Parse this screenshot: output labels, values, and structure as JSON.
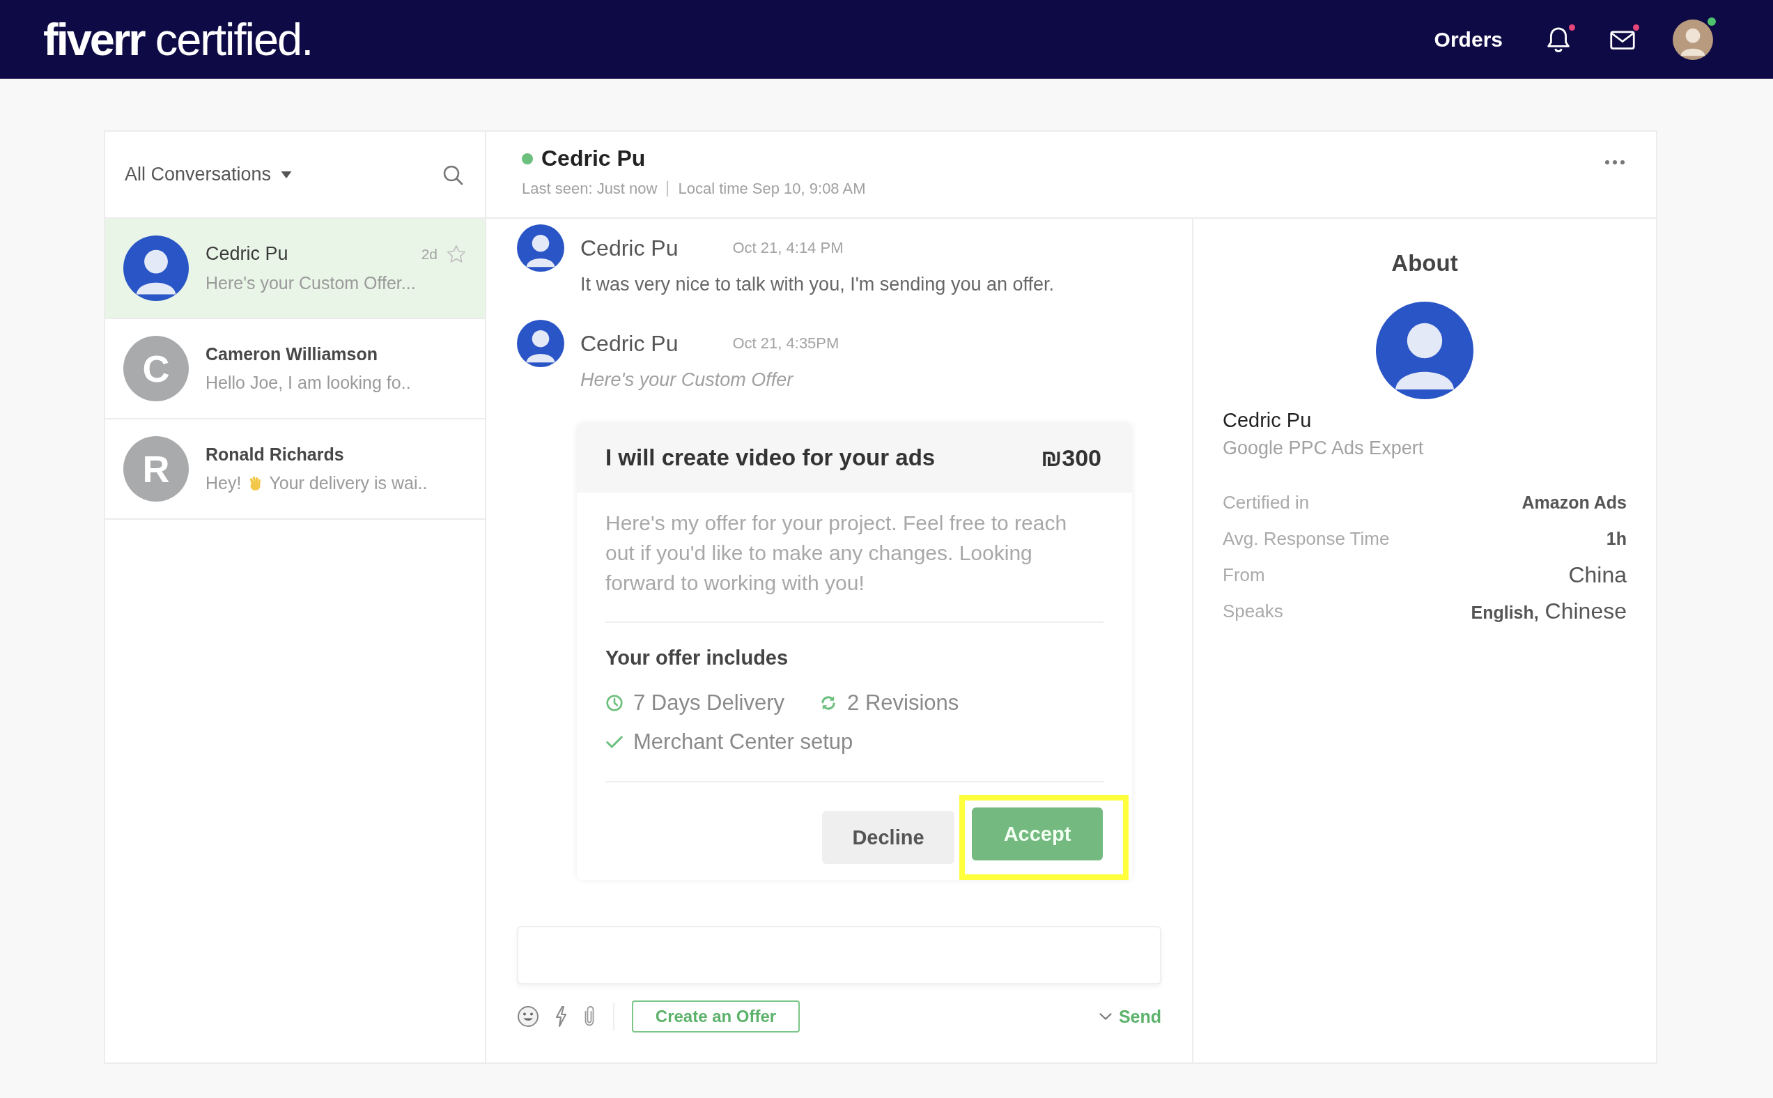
{
  "header": {
    "logo": "**fiverr** certified.",
    "nav": [
      {
        "label": "Orders"
      }
    ],
    "notifications": {
      "unread": true
    },
    "messages": {
      "unread": true
    },
    "user": {
      "online": true
    }
  },
  "sidebar": {
    "filter": {
      "label": "All Conversations"
    },
    "conversations": [
      {
        "name": "Cedric Pu",
        "avatar": {
          "kind": "photo"
        },
        "preview": [
          {
            "kind": "text",
            "text": "Here's your Custom Offer..."
          }
        ],
        "time": "2d",
        "selected": true,
        "unread": false,
        "starred": false
      },
      {
        "name": "Cameron Williamson",
        "avatar": {
          "kind": "initial",
          "text": "C"
        },
        "preview": [
          {
            "kind": "text",
            "text": "Hello Joe, I am looking fo.."
          }
        ],
        "selected": false,
        "unread": true,
        "starred": false
      },
      {
        "name": "Ronald Richards",
        "avatar": {
          "kind": "initial",
          "text": "R"
        },
        "preview": [
          {
            "kind": "text",
            "text": "Hey!"
          },
          {
            "kind": "emoji"
          },
          {
            "kind": "text",
            "text": "Your delivery is wai.."
          }
        ],
        "selected": false,
        "unread": true,
        "starred": false
      }
    ]
  },
  "chat": {
    "contact": {
      "name": "Cedric Pu",
      "online": true,
      "last_seen": "Last seen: Just now",
      "local_time": "Local time Sep 10, 9:08 AM"
    },
    "messages": [
      {
        "kind": "text",
        "sender": "Cedric Pu",
        "time": "Oct 21, 4:14 PM",
        "text": "It was very nice to talk with you, I'm sending you an offer."
      },
      {
        "kind": "offer",
        "sender": "Cedric Pu",
        "time": "Oct 21, 4:35PM",
        "text": "Here's your Custom Offer",
        "offer": {
          "title": "I will create video for your ads",
          "price": "₪300",
          "description": "Here's my offer for your project. Feel free to reach out if you'd like to make any changes. Looking forward to working with you!",
          "includes_heading": "Your offer includes",
          "stats": [
            {
              "kind": "delivery",
              "text": "7 Days Delivery"
            },
            {
              "kind": "revisions",
              "text": "2 Revisions"
            }
          ],
          "extras": [
            {
              "text": "Merchant Center setup"
            }
          ],
          "buttons": [
            {
              "kind": "secondary",
              "label": "Decline",
              "highlighted": false
            },
            {
              "kind": "primary",
              "label": "Accept",
              "highlighted": true
            }
          ]
        }
      }
    ],
    "composer": {
      "offer_button": "Create an Offer",
      "send": "Send"
    }
  },
  "about": {
    "heading": "About",
    "name": "Cedric Pu",
    "title": "Google PPC Ads Expert",
    "details": [
      {
        "label": "Certified in",
        "value": "Amazon Ads",
        "bold": true
      },
      {
        "label": "Avg. Response Time",
        "value": "1h",
        "bold": true
      },
      {
        "label": "From",
        "value": "China",
        "bold": false
      },
      {
        "label": "Speaks",
        "value": "**English,** Chinese",
        "bold": false
      }
    ]
  }
}
